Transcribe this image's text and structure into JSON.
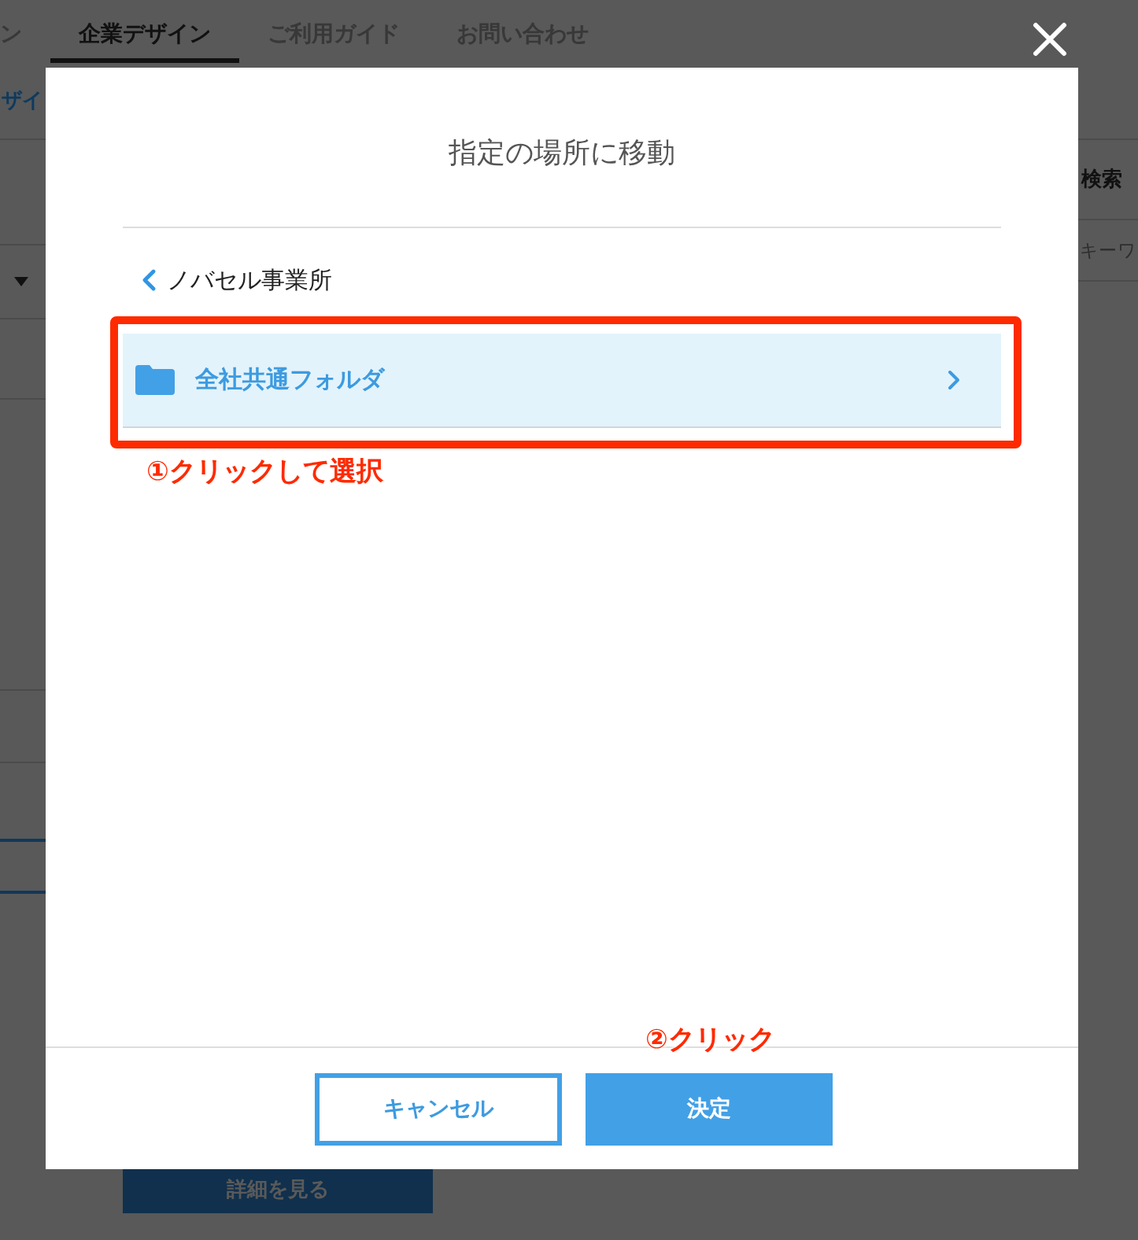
{
  "background_page": {
    "nav_tabs": [
      {
        "label": "ン",
        "selected": false
      },
      {
        "label": "企業デザイン",
        "selected": true
      },
      {
        "label": "ご利用ガイド",
        "selected": false
      },
      {
        "label": "お問い合わせ",
        "selected": false
      }
    ],
    "side_heading": "ザイ",
    "search": {
      "label": "検索",
      "placeholder": "キーワ"
    },
    "details_button": "詳細を見る"
  },
  "dialog": {
    "title": "指定の場所に移動",
    "back_link": "ノバセル事業所",
    "folders": [
      {
        "name": "全社共通フォルダ",
        "selected": true
      }
    ],
    "folder_note": "①クリックして選択",
    "buttons": [
      {
        "label": "キャンセル",
        "kind": "secondary"
      },
      {
        "label": "決定",
        "kind": "primary"
      }
    ],
    "button_note": "②クリック"
  }
}
